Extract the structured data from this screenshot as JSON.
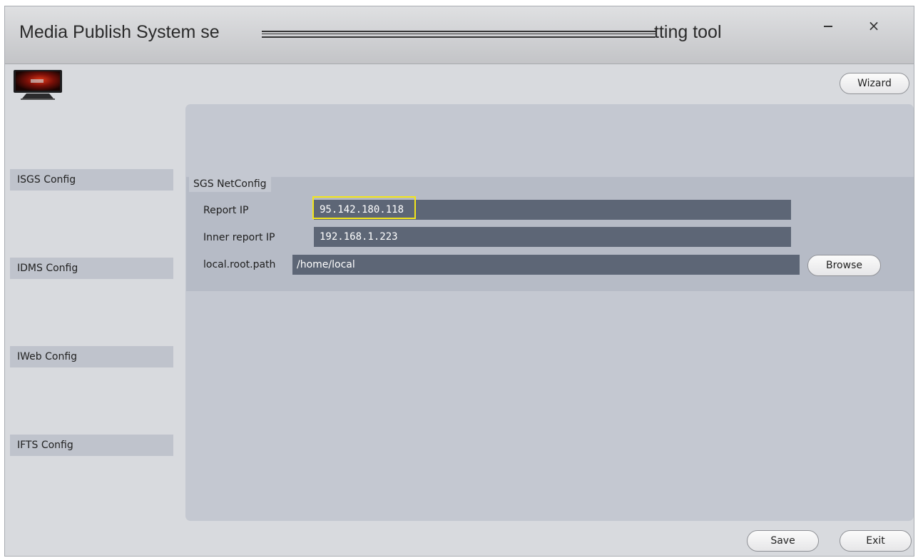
{
  "window": {
    "title_left": "Media Publish System se",
    "title_right": "tting tool",
    "minimize_label": "–",
    "close_label": "×"
  },
  "toolbar": {
    "wizard_label": "Wizard"
  },
  "sidebar": {
    "items": [
      {
        "label": "ISGS Config"
      },
      {
        "label": "IDMS Config"
      },
      {
        "label": "IWeb Config"
      },
      {
        "label": "IFTS Config"
      }
    ]
  },
  "netconfig": {
    "group_title": "SGS NetConfig",
    "report_ip_label": "Report IP",
    "report_ip_value": "95.142.180.118",
    "inner_report_ip_label": "Inner report IP",
    "inner_report_ip_value": "192.168.1.223",
    "local_root_path_label": "local.root.path",
    "local_root_path_value": "/home/local",
    "browse_label": "Browse"
  },
  "footer": {
    "save_label": "Save",
    "exit_label": "Exit"
  },
  "colors": {
    "input_bg": "#5d6676",
    "highlight": "#f3e51a",
    "sidebar_bg": "#bfc3cc",
    "panel_bg": "#c4c8d1"
  },
  "icons": {
    "logo": "monitor-logo-icon",
    "minimize": "minimize-icon",
    "close": "close-icon"
  }
}
